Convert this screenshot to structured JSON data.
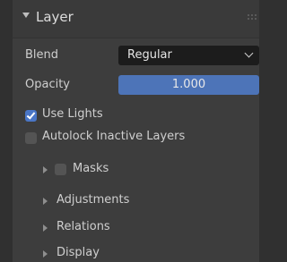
{
  "panel": {
    "title": "Layer",
    "blend_label": "Blend",
    "blend_value": "Regular",
    "opacity_label": "Opacity",
    "opacity_value": "1.000",
    "opacity_fraction": 1.0,
    "use_lights_label": "Use Lights",
    "use_lights_checked": true,
    "autolock_label": "Autolock Inactive Layers",
    "autolock_checked": false
  },
  "subpanels": [
    {
      "label": "Masks",
      "has_checkbox": true
    },
    {
      "label": "Adjustments",
      "has_checkbox": false
    },
    {
      "label": "Relations",
      "has_checkbox": false
    },
    {
      "label": "Display",
      "has_checkbox": false
    }
  ],
  "icons": {
    "header_expand": "triangle-down-icon",
    "subpanel_collapsed": "triangle-right-icon",
    "drag_grip": "grip-icon",
    "dropdown": "chevron-down-icon"
  },
  "colors": {
    "accent": "#4a76c6",
    "slider_fill": "#4d74b8",
    "panel_bg": "#3d3d3d",
    "field_bg": "#1c1c1c"
  }
}
